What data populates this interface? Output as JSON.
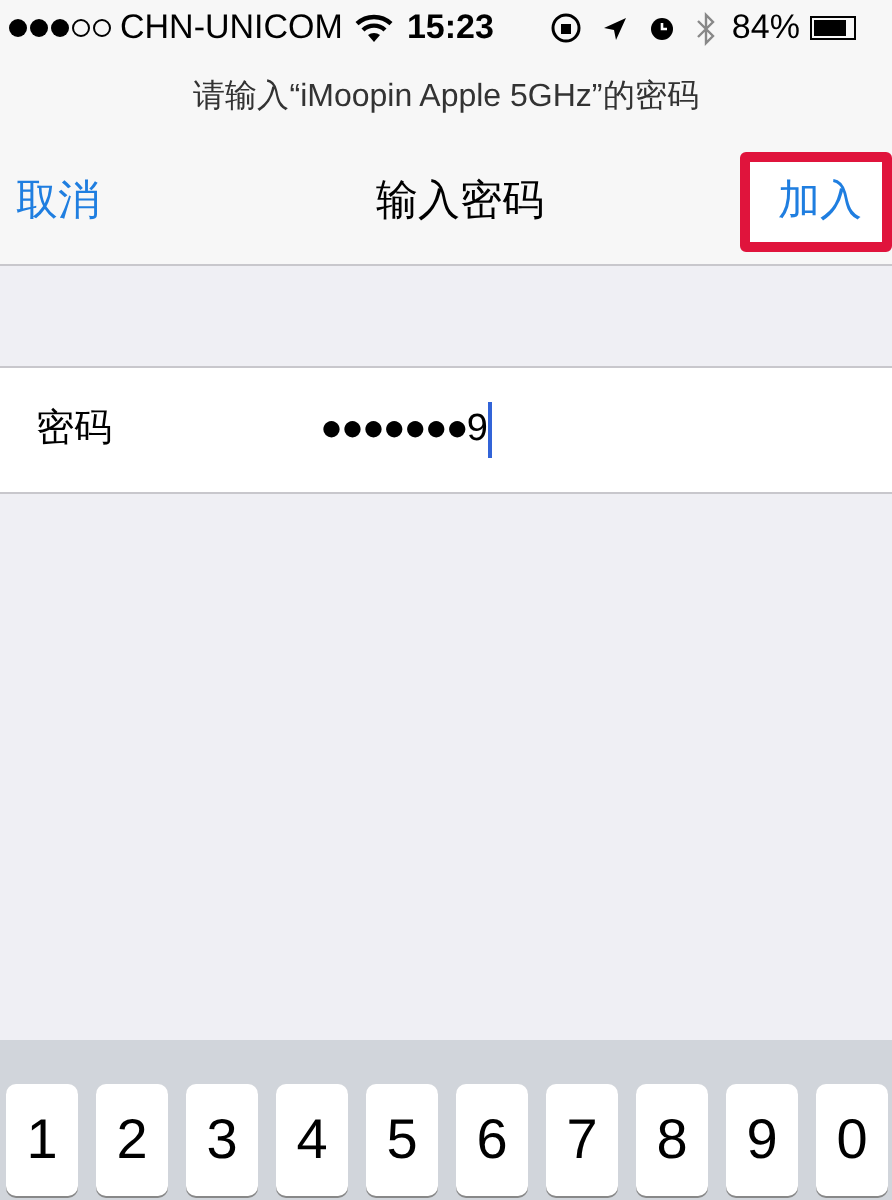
{
  "status_bar": {
    "carrier": "CHN-UNICOM",
    "time": "15:23",
    "battery": "84%"
  },
  "prompt": "请输入“iMoopin Apple 5GHz”的密码",
  "nav_bar": {
    "cancel": "取消",
    "title": "输入密码",
    "join": {
      "label": "加入",
      "highlighted": true
    }
  },
  "password_row": {
    "label": "密码",
    "value": "●●●●●●●9",
    "focused": true
  },
  "keyboard": {
    "keys": [
      "1",
      "2",
      "3",
      "4",
      "5",
      "6",
      "7",
      "8",
      "9",
      "0"
    ]
  }
}
